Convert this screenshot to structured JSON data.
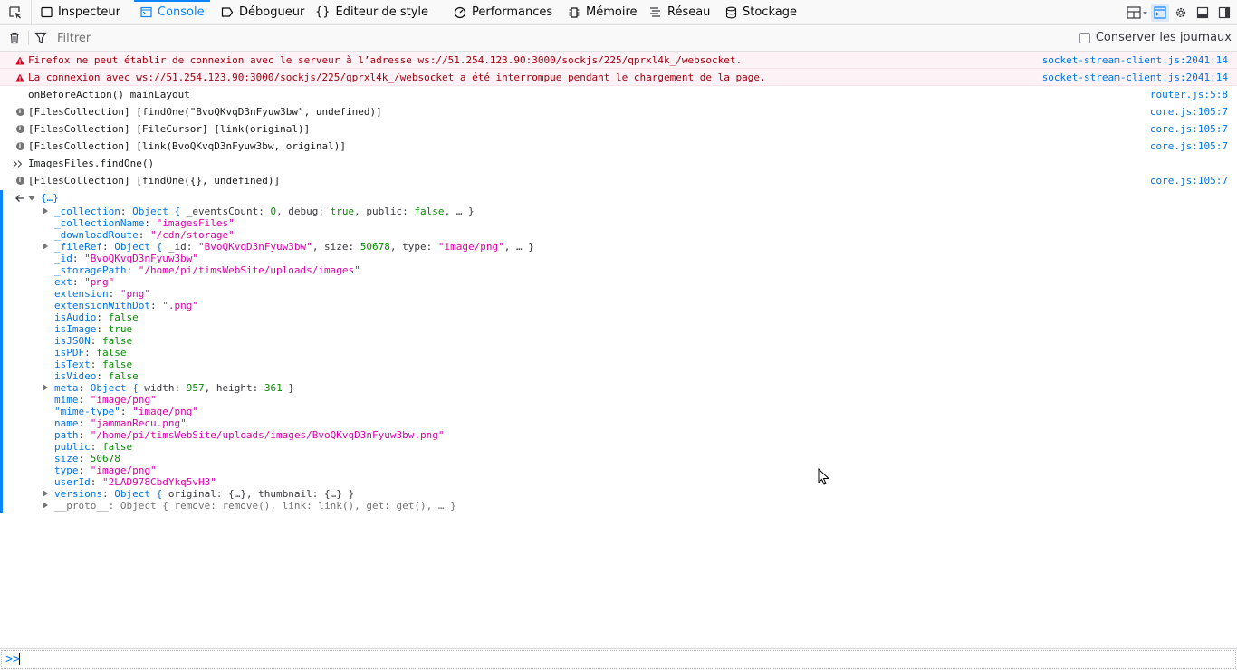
{
  "toolbar": {
    "tabs": [
      {
        "label": "Inspecteur",
        "icon": "inspector-icon"
      },
      {
        "label": "Console",
        "icon": "console-icon",
        "selected": true
      },
      {
        "label": "Débogueur",
        "icon": "debugger-icon"
      },
      {
        "label": "Éditeur de style",
        "icon": "style-editor-icon",
        "glyph": "{}"
      },
      {
        "label": "Performances",
        "icon": "performance-icon"
      },
      {
        "label": "Mémoire",
        "icon": "memory-icon"
      },
      {
        "label": "Réseau",
        "icon": "network-icon"
      },
      {
        "label": "Stockage",
        "icon": "storage-icon"
      }
    ],
    "accent_color": "#0a84ff"
  },
  "filterbar": {
    "placeholder": "Filtrer",
    "persist_label": "Conserver les journaux",
    "persist_checked": false
  },
  "messages": [
    {
      "type": "error",
      "text": "Firefox ne peut établir de connexion avec le serveur à l’adresse ws://51.254.123.90:3000/sockjs/225/qprxl4k_/websocket.",
      "location": "socket-stream-client.js:2041:14"
    },
    {
      "type": "error",
      "text": "La connexion avec ws://51.254.123.90:3000/sockjs/225/qprxl4k_/websocket a été interrompue pendant le chargement de la page.",
      "location": "socket-stream-client.js:2041:14"
    },
    {
      "type": "log",
      "text": "onBeforeAction() mainLayout",
      "location": "router.js:5:8"
    },
    {
      "type": "info",
      "text": "[FilesCollection] [findOne(\"BvoQKvqD3nFyuw3bw\", undefined)]",
      "location": "core.js:105:7"
    },
    {
      "type": "info",
      "text": "[FilesCollection] [FileCursor] [link(original)]",
      "location": "core.js:105:7"
    },
    {
      "type": "info",
      "text": "[FilesCollection] [link(BvoQKvqD3nFyuw3bw, original)]",
      "location": "core.js:105:7"
    },
    {
      "type": "command",
      "text": "ImagesFiles.findOne()",
      "location": ""
    },
    {
      "type": "info",
      "text": "[FilesCollection] [findOne({}, undefined)]",
      "location": "core.js:105:7"
    }
  ],
  "result": {
    "header": "{…}",
    "props": [
      {
        "expandable": true,
        "parts": [
          [
            "k",
            "_collection"
          ],
          [
            "p",
            ": "
          ],
          [
            "kw",
            "Object { "
          ],
          [
            "p",
            "_eventsCount: "
          ],
          [
            "n",
            "0"
          ],
          [
            "p",
            ", debug: "
          ],
          [
            "b",
            "true"
          ],
          [
            "p",
            ", public: "
          ],
          [
            "b",
            "false"
          ],
          [
            "p",
            ", … }"
          ]
        ]
      },
      {
        "expandable": false,
        "parts": [
          [
            "k",
            "_collectionName"
          ],
          [
            "p",
            ": "
          ],
          [
            "s",
            "\"imagesFiles\""
          ]
        ]
      },
      {
        "expandable": false,
        "parts": [
          [
            "k",
            "_downloadRoute"
          ],
          [
            "p",
            ": "
          ],
          [
            "s",
            "\"/cdn/storage\""
          ]
        ]
      },
      {
        "expandable": true,
        "parts": [
          [
            "k",
            "_fileRef"
          ],
          [
            "p",
            ": "
          ],
          [
            "kw",
            "Object { "
          ],
          [
            "p",
            "_id: "
          ],
          [
            "s",
            "\"BvoQKvqD3nFyuw3bw\""
          ],
          [
            "p",
            ", size: "
          ],
          [
            "n",
            "50678"
          ],
          [
            "p",
            ", type: "
          ],
          [
            "s",
            "\"image/png\""
          ],
          [
            "p",
            ", … }"
          ]
        ]
      },
      {
        "expandable": false,
        "parts": [
          [
            "k",
            "_id"
          ],
          [
            "p",
            ": "
          ],
          [
            "s",
            "\"BvoQKvqD3nFyuw3bw\""
          ]
        ]
      },
      {
        "expandable": false,
        "parts": [
          [
            "k",
            "_storagePath"
          ],
          [
            "p",
            ": "
          ],
          [
            "s",
            "\"/home/pi/timsWebSite/uploads/images\""
          ]
        ]
      },
      {
        "expandable": false,
        "parts": [
          [
            "k",
            "ext"
          ],
          [
            "p",
            ": "
          ],
          [
            "s",
            "\"png\""
          ]
        ]
      },
      {
        "expandable": false,
        "parts": [
          [
            "k",
            "extension"
          ],
          [
            "p",
            ": "
          ],
          [
            "s",
            "\"png\""
          ]
        ]
      },
      {
        "expandable": false,
        "parts": [
          [
            "k",
            "extensionWithDot"
          ],
          [
            "p",
            ": "
          ],
          [
            "s",
            "\".png\""
          ]
        ]
      },
      {
        "expandable": false,
        "parts": [
          [
            "k",
            "isAudio"
          ],
          [
            "p",
            ": "
          ],
          [
            "b",
            "false"
          ]
        ]
      },
      {
        "expandable": false,
        "parts": [
          [
            "k",
            "isImage"
          ],
          [
            "p",
            ": "
          ],
          [
            "b",
            "true"
          ]
        ]
      },
      {
        "expandable": false,
        "parts": [
          [
            "k",
            "isJSON"
          ],
          [
            "p",
            ": "
          ],
          [
            "b",
            "false"
          ]
        ]
      },
      {
        "expandable": false,
        "parts": [
          [
            "k",
            "isPDF"
          ],
          [
            "p",
            ": "
          ],
          [
            "b",
            "false"
          ]
        ]
      },
      {
        "expandable": false,
        "parts": [
          [
            "k",
            "isText"
          ],
          [
            "p",
            ": "
          ],
          [
            "b",
            "false"
          ]
        ]
      },
      {
        "expandable": false,
        "parts": [
          [
            "k",
            "isVideo"
          ],
          [
            "p",
            ": "
          ],
          [
            "b",
            "false"
          ]
        ]
      },
      {
        "expandable": true,
        "parts": [
          [
            "k",
            "meta"
          ],
          [
            "p",
            ": "
          ],
          [
            "kw",
            "Object { "
          ],
          [
            "p",
            "width: "
          ],
          [
            "n",
            "957"
          ],
          [
            "p",
            ", height: "
          ],
          [
            "n",
            "361"
          ],
          [
            "p",
            " }"
          ]
        ]
      },
      {
        "expandable": false,
        "parts": [
          [
            "k",
            "mime"
          ],
          [
            "p",
            ": "
          ],
          [
            "s",
            "\"image/png\""
          ]
        ]
      },
      {
        "expandable": false,
        "parts": [
          [
            "k",
            "\"mime-type\""
          ],
          [
            "p",
            ": "
          ],
          [
            "s",
            "\"image/png\""
          ]
        ]
      },
      {
        "expandable": false,
        "parts": [
          [
            "k",
            "name"
          ],
          [
            "p",
            ": "
          ],
          [
            "s",
            "\"jammanRecu.png\""
          ]
        ]
      },
      {
        "expandable": false,
        "parts": [
          [
            "k",
            "path"
          ],
          [
            "p",
            ": "
          ],
          [
            "s",
            "\"/home/pi/timsWebSite/uploads/images/BvoQKvqD3nFyuw3bw.png\""
          ]
        ]
      },
      {
        "expandable": false,
        "parts": [
          [
            "k",
            "public"
          ],
          [
            "p",
            ": "
          ],
          [
            "b",
            "false"
          ]
        ]
      },
      {
        "expandable": false,
        "parts": [
          [
            "k",
            "size"
          ],
          [
            "p",
            ": "
          ],
          [
            "n",
            "50678"
          ]
        ]
      },
      {
        "expandable": false,
        "parts": [
          [
            "k",
            "type"
          ],
          [
            "p",
            ": "
          ],
          [
            "s",
            "\"image/png\""
          ]
        ]
      },
      {
        "expandable": false,
        "parts": [
          [
            "k",
            "userId"
          ],
          [
            "p",
            ": "
          ],
          [
            "s",
            "\"2LAD978CbdYkq5vH3\""
          ]
        ]
      },
      {
        "expandable": true,
        "parts": [
          [
            "k",
            "versions"
          ],
          [
            "p",
            ": "
          ],
          [
            "kw",
            "Object { "
          ],
          [
            "p",
            "original: {…}, thumbnail: {…} }"
          ]
        ]
      },
      {
        "expandable": true,
        "parts": [
          [
            "k-int",
            "__proto__"
          ],
          [
            "k-int",
            ": "
          ],
          [
            "k-int",
            "Object { remove: remove(), link: link(), get: get(), … }"
          ]
        ]
      }
    ]
  },
  "input": {
    "prompt": ">>",
    "value": ""
  }
}
